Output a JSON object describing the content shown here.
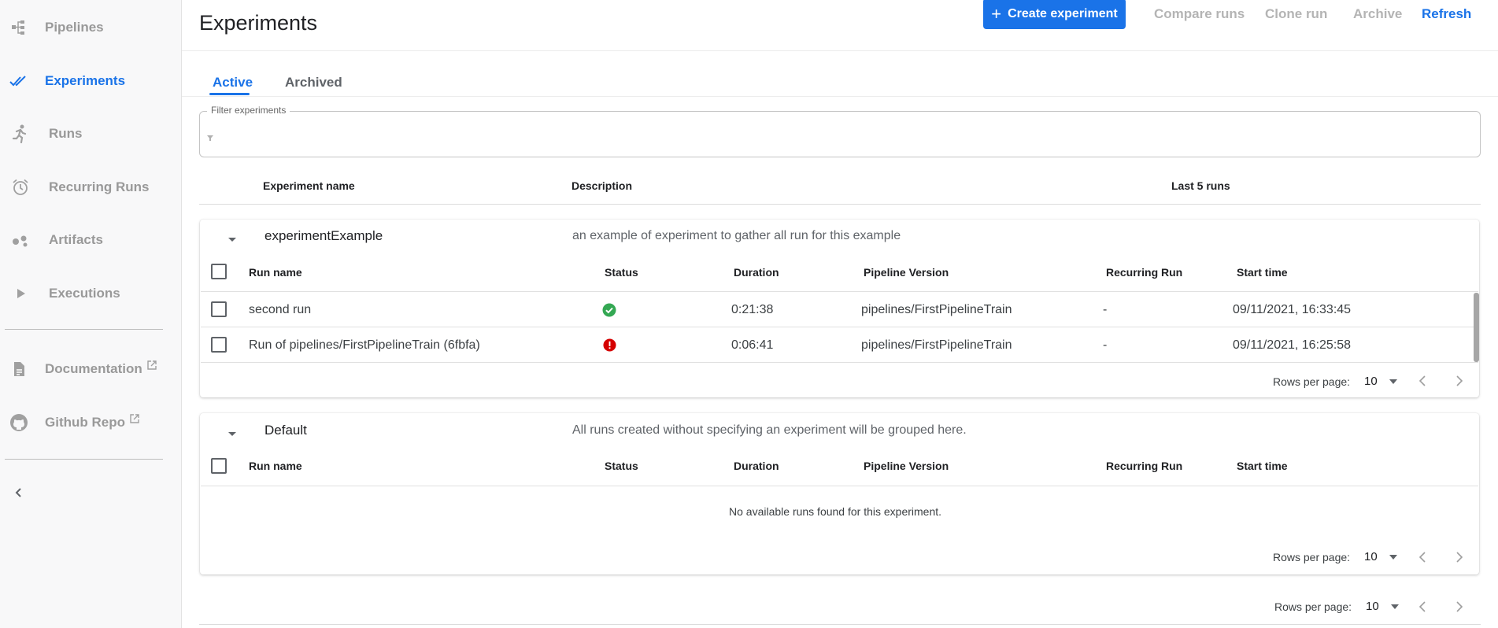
{
  "sidebar": {
    "items": [
      {
        "label": "Pipelines",
        "icon": "pipelines-icon"
      },
      {
        "label": "Experiments",
        "icon": "experiments-icon",
        "active": true
      },
      {
        "label": "Runs",
        "icon": "runs-icon"
      },
      {
        "label": "Recurring Runs",
        "icon": "alarm-clock-icon"
      },
      {
        "label": "Artifacts",
        "icon": "artifacts-icon"
      },
      {
        "label": "Executions",
        "icon": "play-icon"
      }
    ],
    "external_links": [
      {
        "label": "Documentation",
        "icon": "document-icon"
      },
      {
        "label": "Github Repo",
        "icon": "github-icon"
      }
    ],
    "collapse_icon": "chevron-left-icon"
  },
  "header": {
    "title": "Experiments",
    "create_button": "Create experiment",
    "compare_runs": "Compare runs",
    "clone_run": "Clone run",
    "archive": "Archive",
    "refresh": "Refresh"
  },
  "tabs": [
    {
      "label": "Active",
      "active": true
    },
    {
      "label": "Archived"
    }
  ],
  "filter": {
    "label": "Filter experiments",
    "value": ""
  },
  "experiments_table": {
    "columns": [
      "Experiment name",
      "Description",
      "Last 5 runs"
    ]
  },
  "run_columns": [
    "Run name",
    "Status",
    "Duration",
    "Pipeline Version",
    "Recurring Run",
    "Start time"
  ],
  "experiments": [
    {
      "name": "experimentExample",
      "description": "an example of experiment to gather all run for this example",
      "runs": [
        {
          "name": "second run",
          "status": "success",
          "duration": "0:21:38",
          "pipeline_version": "pipelines/FirstPipelineTrain",
          "recurring_run": "-",
          "start_time": "09/11/2021, 16:33:45"
        },
        {
          "name": "Run of pipelines/FirstPipelineTrain (6fbfa)",
          "status": "error",
          "duration": "0:06:41",
          "pipeline_version": "pipelines/FirstPipelineTrain",
          "recurring_run": "-",
          "start_time": "09/11/2021, 16:25:58"
        }
      ],
      "pager": {
        "label": "Rows per page:",
        "value": "10"
      }
    },
    {
      "name": "Default",
      "description": "All runs created without specifying an experiment will be grouped here.",
      "runs": [],
      "empty_message": "No available runs found for this experiment.",
      "pager": {
        "label": "Rows per page:",
        "value": "10"
      }
    }
  ],
  "main_pager": {
    "label": "Rows per page:",
    "value": "10"
  },
  "colors": {
    "accent": "#1a73e8",
    "success": "#34a853",
    "error": "#d50000",
    "muted": "#999999"
  }
}
